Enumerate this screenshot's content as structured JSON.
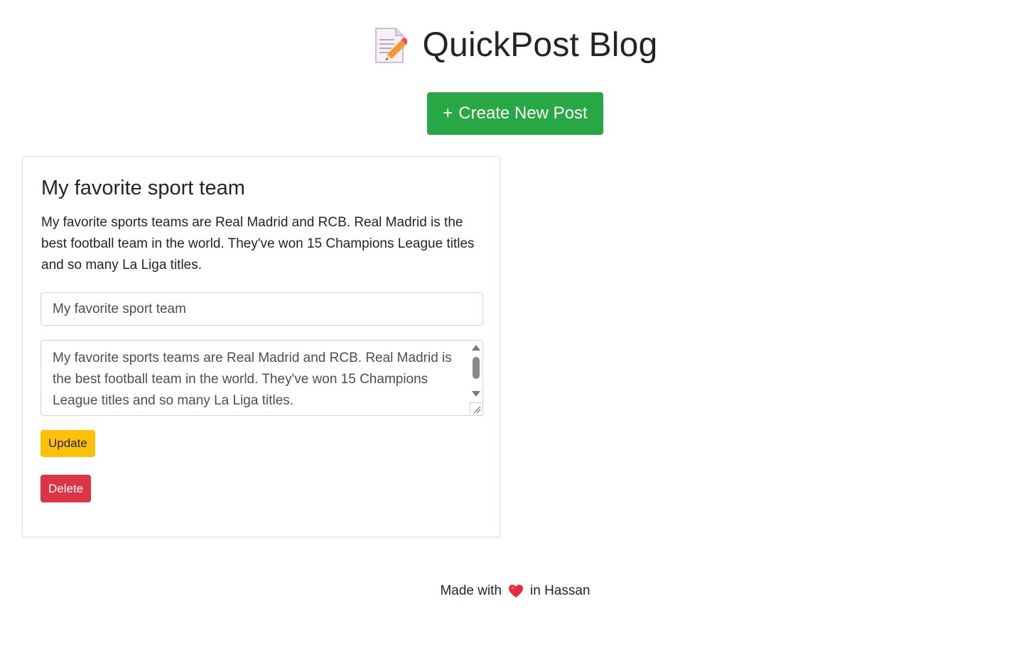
{
  "header": {
    "title": "QuickPost Blog",
    "icon": "memo-icon"
  },
  "actions": {
    "create_label": "Create New Post",
    "create_prefix": "+"
  },
  "post": {
    "title": "My favorite sport team",
    "body": "My favorite sports teams are Real Madrid and RCB. Real Madrid is the best football team in the world. They've won 15 Champions League titles and so many La Liga titles.",
    "edit_title_value": "My favorite sport team",
    "edit_body_value": "My favorite sports teams are Real Madrid and RCB. Real Madrid is the best football team in the world. They've won 15 Champions League titles and so many La Liga titles.",
    "update_label": "Update",
    "delete_label": "Delete"
  },
  "footer": {
    "prefix": "Made with",
    "suffix": "in Hassan",
    "icon": "heart-icon"
  },
  "colors": {
    "create": "#28a745",
    "update": "#ffc107",
    "delete": "#dc3545",
    "heart": "#e8283c"
  }
}
